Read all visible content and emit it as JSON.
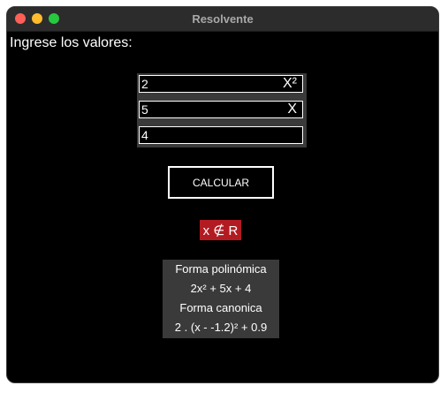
{
  "window": {
    "title": "Resolvente"
  },
  "prompt": "Ingrese los valores:",
  "inputs": [
    {
      "value": "2",
      "suffix": "X²"
    },
    {
      "value": "5",
      "suffix": "X"
    },
    {
      "value": "4",
      "suffix": ""
    }
  ],
  "button": {
    "label": "CALCULAR"
  },
  "result": {
    "label": "x ∉ R",
    "color": "#b31b22"
  },
  "forms": {
    "polinomica_label": "Forma polinómica",
    "polinomica_value": "2x² + 5x + 4",
    "canonica_label": "Forma canonica",
    "canonica_value": "2 . (x - -1.2)² + 0.9"
  }
}
